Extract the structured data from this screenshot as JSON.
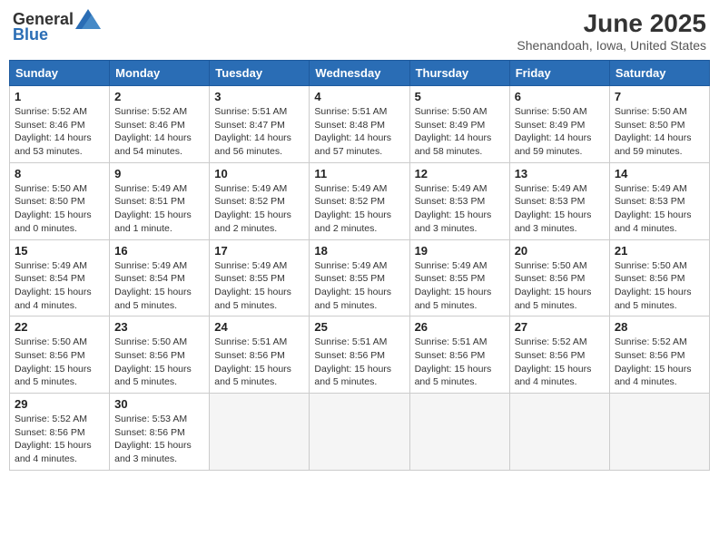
{
  "header": {
    "logo_general": "General",
    "logo_blue": "Blue",
    "month_title": "June 2025",
    "location": "Shenandoah, Iowa, United States"
  },
  "days_of_week": [
    "Sunday",
    "Monday",
    "Tuesday",
    "Wednesday",
    "Thursday",
    "Friday",
    "Saturday"
  ],
  "weeks": [
    [
      {
        "day": "1",
        "sunrise": "5:52 AM",
        "sunset": "8:46 PM",
        "daylight": "14 hours and 53 minutes."
      },
      {
        "day": "2",
        "sunrise": "5:52 AM",
        "sunset": "8:46 PM",
        "daylight": "14 hours and 54 minutes."
      },
      {
        "day": "3",
        "sunrise": "5:51 AM",
        "sunset": "8:47 PM",
        "daylight": "14 hours and 56 minutes."
      },
      {
        "day": "4",
        "sunrise": "5:51 AM",
        "sunset": "8:48 PM",
        "daylight": "14 hours and 57 minutes."
      },
      {
        "day": "5",
        "sunrise": "5:50 AM",
        "sunset": "8:49 PM",
        "daylight": "14 hours and 58 minutes."
      },
      {
        "day": "6",
        "sunrise": "5:50 AM",
        "sunset": "8:49 PM",
        "daylight": "14 hours and 59 minutes."
      },
      {
        "day": "7",
        "sunrise": "5:50 AM",
        "sunset": "8:50 PM",
        "daylight": "14 hours and 59 minutes."
      }
    ],
    [
      {
        "day": "8",
        "sunrise": "5:50 AM",
        "sunset": "8:50 PM",
        "daylight": "15 hours and 0 minutes."
      },
      {
        "day": "9",
        "sunrise": "5:49 AM",
        "sunset": "8:51 PM",
        "daylight": "15 hours and 1 minute."
      },
      {
        "day": "10",
        "sunrise": "5:49 AM",
        "sunset": "8:52 PM",
        "daylight": "15 hours and 2 minutes."
      },
      {
        "day": "11",
        "sunrise": "5:49 AM",
        "sunset": "8:52 PM",
        "daylight": "15 hours and 2 minutes."
      },
      {
        "day": "12",
        "sunrise": "5:49 AM",
        "sunset": "8:53 PM",
        "daylight": "15 hours and 3 minutes."
      },
      {
        "day": "13",
        "sunrise": "5:49 AM",
        "sunset": "8:53 PM",
        "daylight": "15 hours and 3 minutes."
      },
      {
        "day": "14",
        "sunrise": "5:49 AM",
        "sunset": "8:53 PM",
        "daylight": "15 hours and 4 minutes."
      }
    ],
    [
      {
        "day": "15",
        "sunrise": "5:49 AM",
        "sunset": "8:54 PM",
        "daylight": "15 hours and 4 minutes."
      },
      {
        "day": "16",
        "sunrise": "5:49 AM",
        "sunset": "8:54 PM",
        "daylight": "15 hours and 5 minutes."
      },
      {
        "day": "17",
        "sunrise": "5:49 AM",
        "sunset": "8:55 PM",
        "daylight": "15 hours and 5 minutes."
      },
      {
        "day": "18",
        "sunrise": "5:49 AM",
        "sunset": "8:55 PM",
        "daylight": "15 hours and 5 minutes."
      },
      {
        "day": "19",
        "sunrise": "5:49 AM",
        "sunset": "8:55 PM",
        "daylight": "15 hours and 5 minutes."
      },
      {
        "day": "20",
        "sunrise": "5:50 AM",
        "sunset": "8:56 PM",
        "daylight": "15 hours and 5 minutes."
      },
      {
        "day": "21",
        "sunrise": "5:50 AM",
        "sunset": "8:56 PM",
        "daylight": "15 hours and 5 minutes."
      }
    ],
    [
      {
        "day": "22",
        "sunrise": "5:50 AM",
        "sunset": "8:56 PM",
        "daylight": "15 hours and 5 minutes."
      },
      {
        "day": "23",
        "sunrise": "5:50 AM",
        "sunset": "8:56 PM",
        "daylight": "15 hours and 5 minutes."
      },
      {
        "day": "24",
        "sunrise": "5:51 AM",
        "sunset": "8:56 PM",
        "daylight": "15 hours and 5 minutes."
      },
      {
        "day": "25",
        "sunrise": "5:51 AM",
        "sunset": "8:56 PM",
        "daylight": "15 hours and 5 minutes."
      },
      {
        "day": "26",
        "sunrise": "5:51 AM",
        "sunset": "8:56 PM",
        "daylight": "15 hours and 5 minutes."
      },
      {
        "day": "27",
        "sunrise": "5:52 AM",
        "sunset": "8:56 PM",
        "daylight": "15 hours and 4 minutes."
      },
      {
        "day": "28",
        "sunrise": "5:52 AM",
        "sunset": "8:56 PM",
        "daylight": "15 hours and 4 minutes."
      }
    ],
    [
      {
        "day": "29",
        "sunrise": "5:52 AM",
        "sunset": "8:56 PM",
        "daylight": "15 hours and 4 minutes."
      },
      {
        "day": "30",
        "sunrise": "5:53 AM",
        "sunset": "8:56 PM",
        "daylight": "15 hours and 3 minutes."
      },
      null,
      null,
      null,
      null,
      null
    ]
  ]
}
